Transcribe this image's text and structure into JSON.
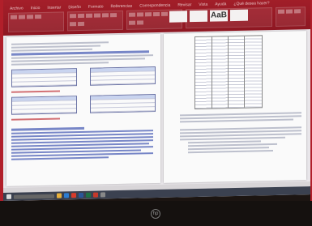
{
  "ribbon": {
    "tabs": [
      "Archivo",
      "Inicio",
      "Insertar",
      "Diseño",
      "Formato",
      "Referencias",
      "Correspondencia",
      "Revisar",
      "Vista",
      "Ayuda",
      "¿Qué desea hacer?"
    ],
    "style_big": "AaB"
  },
  "colors": {
    "ribbon": "#a51f2a",
    "page": "#fafafa",
    "taskbar": "#3b4150"
  }
}
